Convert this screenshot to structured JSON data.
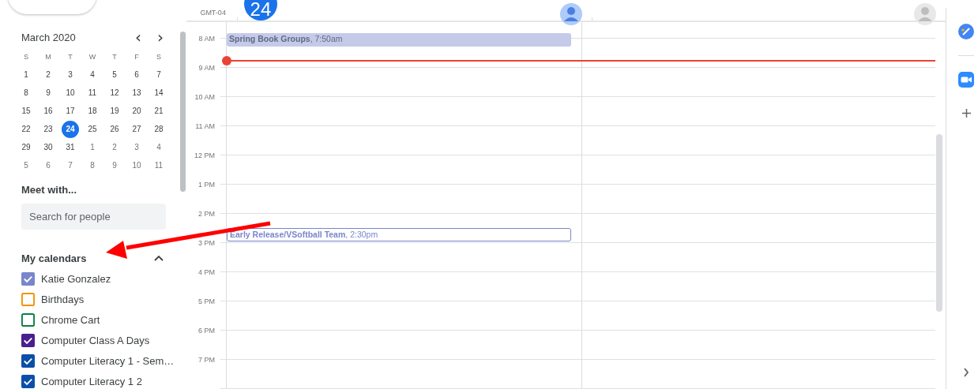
{
  "mini_calendar": {
    "title": "March 2020",
    "prev": "‹",
    "next": "›",
    "weekdays": [
      "S",
      "M",
      "T",
      "W",
      "T",
      "F",
      "S"
    ],
    "days": [
      {
        "label": "1",
        "other_month": false,
        "selected": false
      },
      {
        "label": "2",
        "other_month": false,
        "selected": false
      },
      {
        "label": "3",
        "other_month": false,
        "selected": false
      },
      {
        "label": "4",
        "other_month": false,
        "selected": false
      },
      {
        "label": "5",
        "other_month": false,
        "selected": false
      },
      {
        "label": "6",
        "other_month": false,
        "selected": false
      },
      {
        "label": "7",
        "other_month": false,
        "selected": false
      },
      {
        "label": "8",
        "other_month": false,
        "selected": false
      },
      {
        "label": "9",
        "other_month": false,
        "selected": false
      },
      {
        "label": "10",
        "other_month": false,
        "selected": false
      },
      {
        "label": "11",
        "other_month": false,
        "selected": false
      },
      {
        "label": "12",
        "other_month": false,
        "selected": false
      },
      {
        "label": "13",
        "other_month": false,
        "selected": false
      },
      {
        "label": "14",
        "other_month": false,
        "selected": false
      },
      {
        "label": "15",
        "other_month": false,
        "selected": false
      },
      {
        "label": "16",
        "other_month": false,
        "selected": false
      },
      {
        "label": "17",
        "other_month": false,
        "selected": false
      },
      {
        "label": "18",
        "other_month": false,
        "selected": false
      },
      {
        "label": "19",
        "other_month": false,
        "selected": false
      },
      {
        "label": "20",
        "other_month": false,
        "selected": false
      },
      {
        "label": "21",
        "other_month": false,
        "selected": false
      },
      {
        "label": "22",
        "other_month": false,
        "selected": false
      },
      {
        "label": "23",
        "other_month": false,
        "selected": false
      },
      {
        "label": "24",
        "other_month": false,
        "selected": true
      },
      {
        "label": "25",
        "other_month": false,
        "selected": false
      },
      {
        "label": "26",
        "other_month": false,
        "selected": false
      },
      {
        "label": "27",
        "other_month": false,
        "selected": false
      },
      {
        "label": "28",
        "other_month": false,
        "selected": false
      },
      {
        "label": "29",
        "other_month": false,
        "selected": false
      },
      {
        "label": "30",
        "other_month": false,
        "selected": false
      },
      {
        "label": "31",
        "other_month": false,
        "selected": false
      },
      {
        "label": "1",
        "other_month": true,
        "selected": false
      },
      {
        "label": "2",
        "other_month": true,
        "selected": false
      },
      {
        "label": "3",
        "other_month": true,
        "selected": false
      },
      {
        "label": "4",
        "other_month": true,
        "selected": false
      },
      {
        "label": "5",
        "other_month": true,
        "selected": false
      },
      {
        "label": "6",
        "other_month": true,
        "selected": false
      },
      {
        "label": "7",
        "other_month": true,
        "selected": false
      },
      {
        "label": "8",
        "other_month": true,
        "selected": false
      },
      {
        "label": "9",
        "other_month": true,
        "selected": false
      },
      {
        "label": "10",
        "other_month": true,
        "selected": false
      },
      {
        "label": "11",
        "other_month": true,
        "selected": false
      }
    ]
  },
  "meet_with": {
    "title": "Meet with...",
    "search": {
      "placeholder": "Search for people"
    }
  },
  "my_calendars": {
    "title": "My calendars",
    "expanded": true,
    "items": [
      {
        "label": "Katie Gonzalez",
        "checked": true,
        "color": "#7986cb"
      },
      {
        "label": "Birthdays",
        "checked": false,
        "color": "#f09300"
      },
      {
        "label": "Chrome Cart",
        "checked": false,
        "color": "#0b8043"
      },
      {
        "label": "Computer Class A Days",
        "checked": true,
        "color": "#4a1f8f"
      },
      {
        "label": "Computer Literacy 1 - Sem…",
        "checked": true,
        "color": "#0b4fa8"
      },
      {
        "label": "Computer Literacy 1 2",
        "checked": true,
        "color": "#0b4fa8"
      }
    ]
  },
  "day_view": {
    "date": "24",
    "timezone": "GMT-04",
    "hours": [
      "8 AM",
      "9 AM",
      "10 AM",
      "11 AM",
      "12 PM",
      "1 PM",
      "2 PM",
      "3 PM",
      "4 PM",
      "5 PM",
      "6 PM",
      "7 PM"
    ],
    "events": [
      {
        "text": "**Spring Book Groups**, 7:50am",
        "kind": "filled"
      },
      {
        "text": "**Early Release/VSoftball Team**, 2:30pm",
        "kind": "outlined"
      }
    ]
  }
}
